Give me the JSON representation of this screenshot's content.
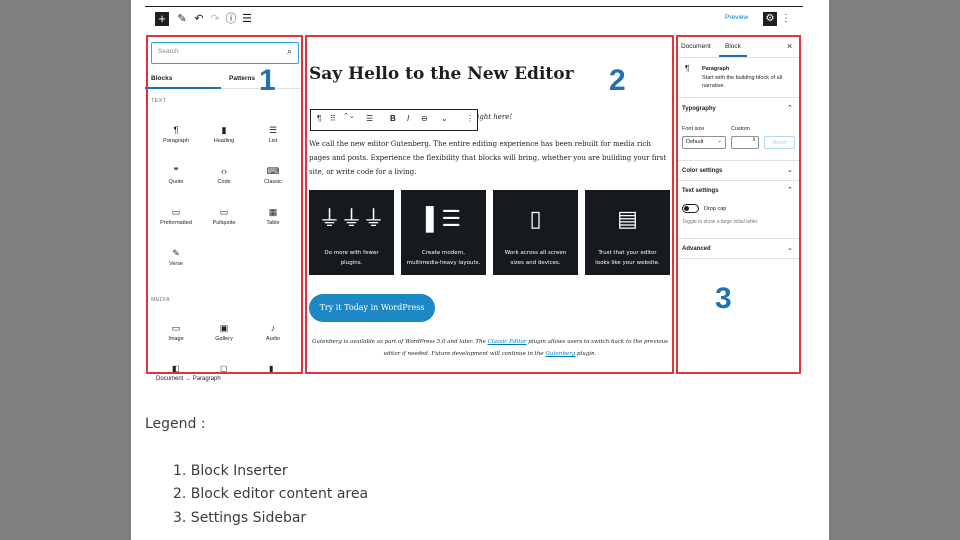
{
  "toolbar": {
    "add_icon": "plus-icon",
    "preview_label": "Preview",
    "icons": [
      "pencil-icon",
      "undo-icon",
      "redo-icon",
      "info-icon",
      "list-view-icon"
    ]
  },
  "inserter": {
    "search_placeholder": "Search",
    "tabs": [
      "Blocks",
      "Patterns"
    ],
    "text_section_label": "TEXT",
    "media_section_label": "MEDIA",
    "text_blocks": [
      {
        "label": "Paragraph",
        "glyph": "¶"
      },
      {
        "label": "Heading",
        "glyph": "▮"
      },
      {
        "label": "List",
        "glyph": "☰"
      },
      {
        "label": "Quote",
        "glyph": "❞"
      },
      {
        "label": "Code",
        "glyph": "‹›"
      },
      {
        "label": "Classic",
        "glyph": "⌨"
      },
      {
        "label": "Preformatted",
        "glyph": "▭"
      },
      {
        "label": "Pullquote",
        "glyph": "▭"
      },
      {
        "label": "Table",
        "glyph": "▦"
      },
      {
        "label": "Verse",
        "glyph": "✎"
      }
    ],
    "media_blocks": [
      {
        "label": "Image",
        "glyph": "▭"
      },
      {
        "label": "Gallery",
        "glyph": "▣"
      },
      {
        "label": "Audio",
        "glyph": "♪"
      }
    ],
    "breadcrumb": [
      "Document",
      "→",
      "Paragraph"
    ]
  },
  "content": {
    "title": "Say Hello to the New Editor",
    "partial_italic": "ight here!",
    "block_toolbar": [
      "¶",
      "⠿",
      "⌃⌄",
      "☰",
      "B",
      "I",
      "⊖",
      "⌄",
      "⋮"
    ],
    "paragraph": "We call the new editor Gutenberg. The entire editing experience has been rebuilt for media rich pages and posts. Experience the flexibility that blocks will bring, whether you are building your first site, or write code for a living.",
    "cards": [
      {
        "icon": "plugs-icon",
        "glyph": "⏚⏚⏚",
        "line1": "Do more with fewer",
        "line2": "plugins."
      },
      {
        "icon": "layout-icon",
        "glyph": "▌☰",
        "line1": "Create modern,",
        "line2": "multimedia-heavy layouts."
      },
      {
        "icon": "mobile-icon",
        "glyph": "▯",
        "line1": "Work across all screen",
        "line2": "sizes and devices."
      },
      {
        "icon": "template-icon",
        "glyph": "▤",
        "line1": "Trust that your editor",
        "line2": "looks like your website."
      }
    ],
    "cta_label": "Try it Today in WordPress",
    "fine_1": "Gutenberg is available as part of WordPress 5.0 and later. The ",
    "fine_link1": "Classic Editor",
    "fine_2": " plugin allows users to switch back to the previous editor if needed. Future development will continue in the ",
    "fine_link2": "Gutenberg",
    "fine_3": " plugin."
  },
  "sidebar": {
    "tabs": [
      "Document",
      "Block"
    ],
    "close_glyph": "×",
    "block_name": "Paragraph",
    "block_desc": "Start with the building block of all narrative.",
    "typography_label": "Typography",
    "font_size_label": "Font size",
    "custom_label": "Custom",
    "font_size_value": "Default",
    "reset_label": "Reset",
    "color_settings_label": "Color settings",
    "text_settings_label": "Text settings",
    "drop_cap_label": "Drop cap",
    "drop_cap_help": "Toggle to show a large initial letter.",
    "advanced_label": "Advanced"
  },
  "callouts": [
    "1",
    "2",
    "3"
  ],
  "legend": {
    "title": "Legend :",
    "items": [
      "1. Block Inserter",
      "2. Block editor content area",
      "3. Settings Sidebar"
    ]
  },
  "colors": {
    "panel_border": "#e0343d",
    "accent_blue": "#2271b1",
    "cta_blue": "#1e88c7",
    "card_bg": "#16191d"
  }
}
